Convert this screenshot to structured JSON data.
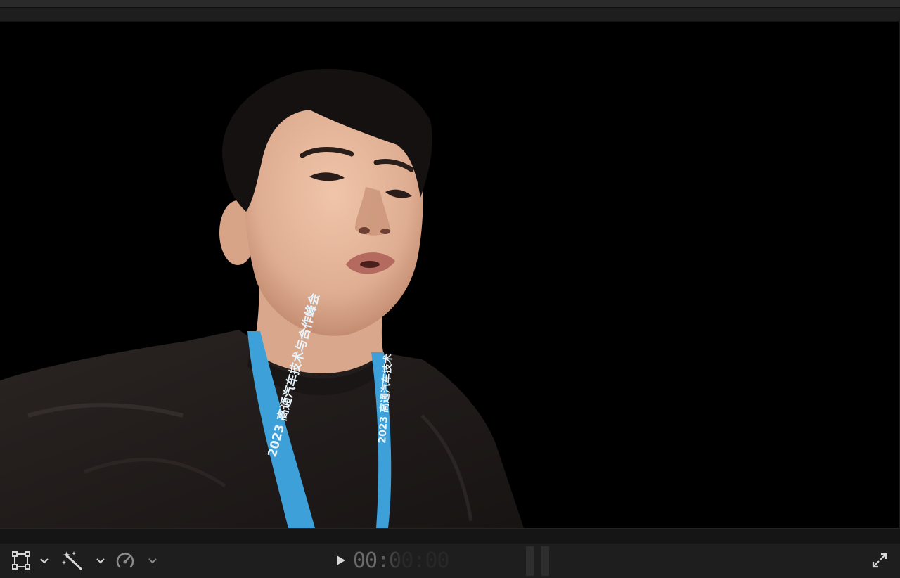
{
  "colors": {
    "background": "#1b1b1b",
    "viewer": "#000000",
    "icon": "#d6d6d6",
    "timecode": "#6b6b6b",
    "lanyard": "#3ea0d8",
    "shirt": "#1f1b1a",
    "skin": "#e6b79c",
    "hair": "#141110"
  },
  "viewer": {
    "lanyard_text_left": "2023 高通汽车技术与合作峰会",
    "lanyard_text_right": "2023 高通汽车技术"
  },
  "toolbar": {
    "transform_tool_icon": "transform-icon",
    "enhance_tool_icon": "magic-wand-icon",
    "speed_tool_icon": "speedometer-icon",
    "play_icon": "play-icon",
    "fullscreen_icon": "fullscreen-icon",
    "timecode": "00:00:00"
  }
}
